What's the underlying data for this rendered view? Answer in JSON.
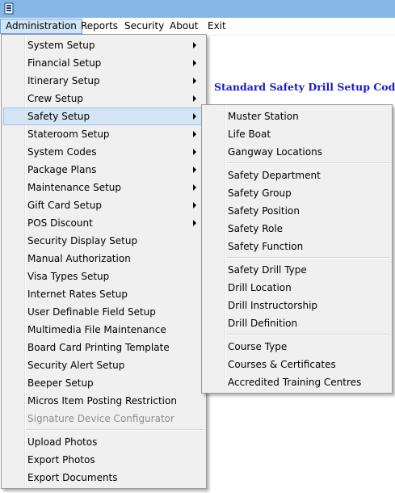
{
  "menubar": {
    "items": [
      {
        "label": "Administration"
      },
      {
        "label": "Reports"
      },
      {
        "label": "Security"
      },
      {
        "label": "About"
      },
      {
        "label": "Exit"
      }
    ]
  },
  "page": {
    "heading": "Standard Safety Drill Setup Codes"
  },
  "admin_menu": {
    "items": [
      {
        "label": "System Setup",
        "submenu": true
      },
      {
        "label": "Financial Setup",
        "submenu": true
      },
      {
        "label": "Itinerary Setup",
        "submenu": true
      },
      {
        "label": "Crew Setup",
        "submenu": true
      },
      {
        "label": "Safety Setup",
        "submenu": true,
        "highlighted": true
      },
      {
        "label": "Stateroom Setup",
        "submenu": true
      },
      {
        "label": "System Codes",
        "submenu": true
      },
      {
        "label": "Package Plans",
        "submenu": true
      },
      {
        "label": "Maintenance Setup",
        "submenu": true
      },
      {
        "label": "Gift Card Setup",
        "submenu": true
      },
      {
        "label": "POS Discount",
        "submenu": true
      },
      {
        "label": "Security Display Setup"
      },
      {
        "label": "Manual Authorization"
      },
      {
        "label": "Visa Types Setup"
      },
      {
        "label": "Internet Rates Setup"
      },
      {
        "label": "User Definable Field Setup"
      },
      {
        "label": "Multimedia File Maintenance"
      },
      {
        "label": "Board Card Printing Template"
      },
      {
        "label": "Security Alert Setup"
      },
      {
        "label": "Beeper Setup"
      },
      {
        "label": "Micros Item Posting Restriction"
      },
      {
        "label": "Signature Device Configurator",
        "disabled": true
      },
      {
        "label": "Upload Photos"
      },
      {
        "label": "Export Photos"
      },
      {
        "label": "Export Documents"
      }
    ]
  },
  "safety_menu": {
    "items": [
      {
        "label": "Muster Station"
      },
      {
        "label": "Life Boat"
      },
      {
        "label": "Gangway Locations"
      },
      {
        "label": "Safety Department"
      },
      {
        "label": "Safety Group"
      },
      {
        "label": "Safety Position"
      },
      {
        "label": "Safety Role"
      },
      {
        "label": "Safety Function"
      },
      {
        "label": "Safety Drill Type"
      },
      {
        "label": "Drill Location"
      },
      {
        "label": "Drill Instructorship"
      },
      {
        "label": "Drill Definition"
      },
      {
        "label": "Course Type"
      },
      {
        "label": "Courses & Certificates"
      },
      {
        "label": "Accredited Training Centres"
      }
    ]
  },
  "colors": {
    "titlebar": "#86b6e6",
    "menu_background": "#f0f0f0",
    "highlight": "#d6e5f5",
    "heading_text": "#1919c8",
    "disabled_text": "#8d8d8d"
  }
}
